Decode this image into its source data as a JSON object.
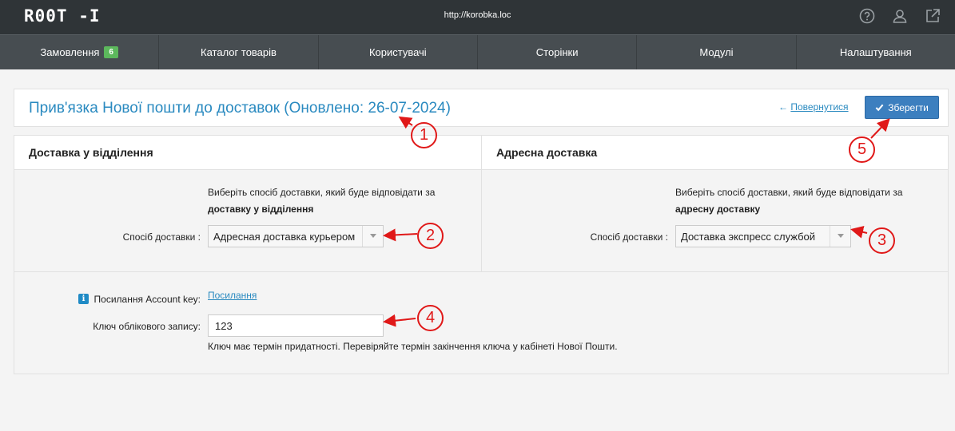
{
  "topbar": {
    "logo": "R00T -I",
    "url": "http://korobka.loc",
    "icons": [
      "help-icon",
      "user-icon",
      "external-link-icon"
    ]
  },
  "nav": {
    "items": [
      {
        "label": "Замовлення",
        "badge": "6"
      },
      {
        "label": "Каталог товарів"
      },
      {
        "label": "Користувачі"
      },
      {
        "label": "Сторінки"
      },
      {
        "label": "Модулі"
      },
      {
        "label": "Налаштування"
      }
    ]
  },
  "header": {
    "title": "Прив'язка Нової пошти до доставок (Оновлено: 26-07-2024)",
    "back_arrow": "←",
    "back_label": "Повернутися",
    "save_label": "Зберегти"
  },
  "branch_delivery": {
    "heading": "Доставка у відділення",
    "help_line1": "Виберіть спосіб доставки, який буде відповідати за",
    "help_line2": "доставку у відділення",
    "field_label": "Спосіб доставки :",
    "selected": "Адресная доставка курьером"
  },
  "address_delivery": {
    "heading": "Адресна доставка",
    "help_line1": "Виберіть спосіб доставки, який буде відповідати за",
    "help_line2": "адресну доставку",
    "field_label": "Спосіб доставки :",
    "selected": "Доставка экспресс службой"
  },
  "account": {
    "link_label": "Посилання Account key:",
    "link_text": "Посилання",
    "key_label": "Ключ облікового запису:",
    "key_value": "123",
    "note": "Ключ має термін придатності. Перевіряйте термін закінчення ключа у кабінеті Нової Пошти."
  },
  "annotations": [
    "1",
    "2",
    "3",
    "4",
    "5"
  ],
  "colors": {
    "accent": "#2a8ac0",
    "topbar": "#2f3437",
    "nav": "#474d51",
    "badge": "#5cb85c",
    "save": "#3c7fbf",
    "annotation": "#e01818"
  }
}
